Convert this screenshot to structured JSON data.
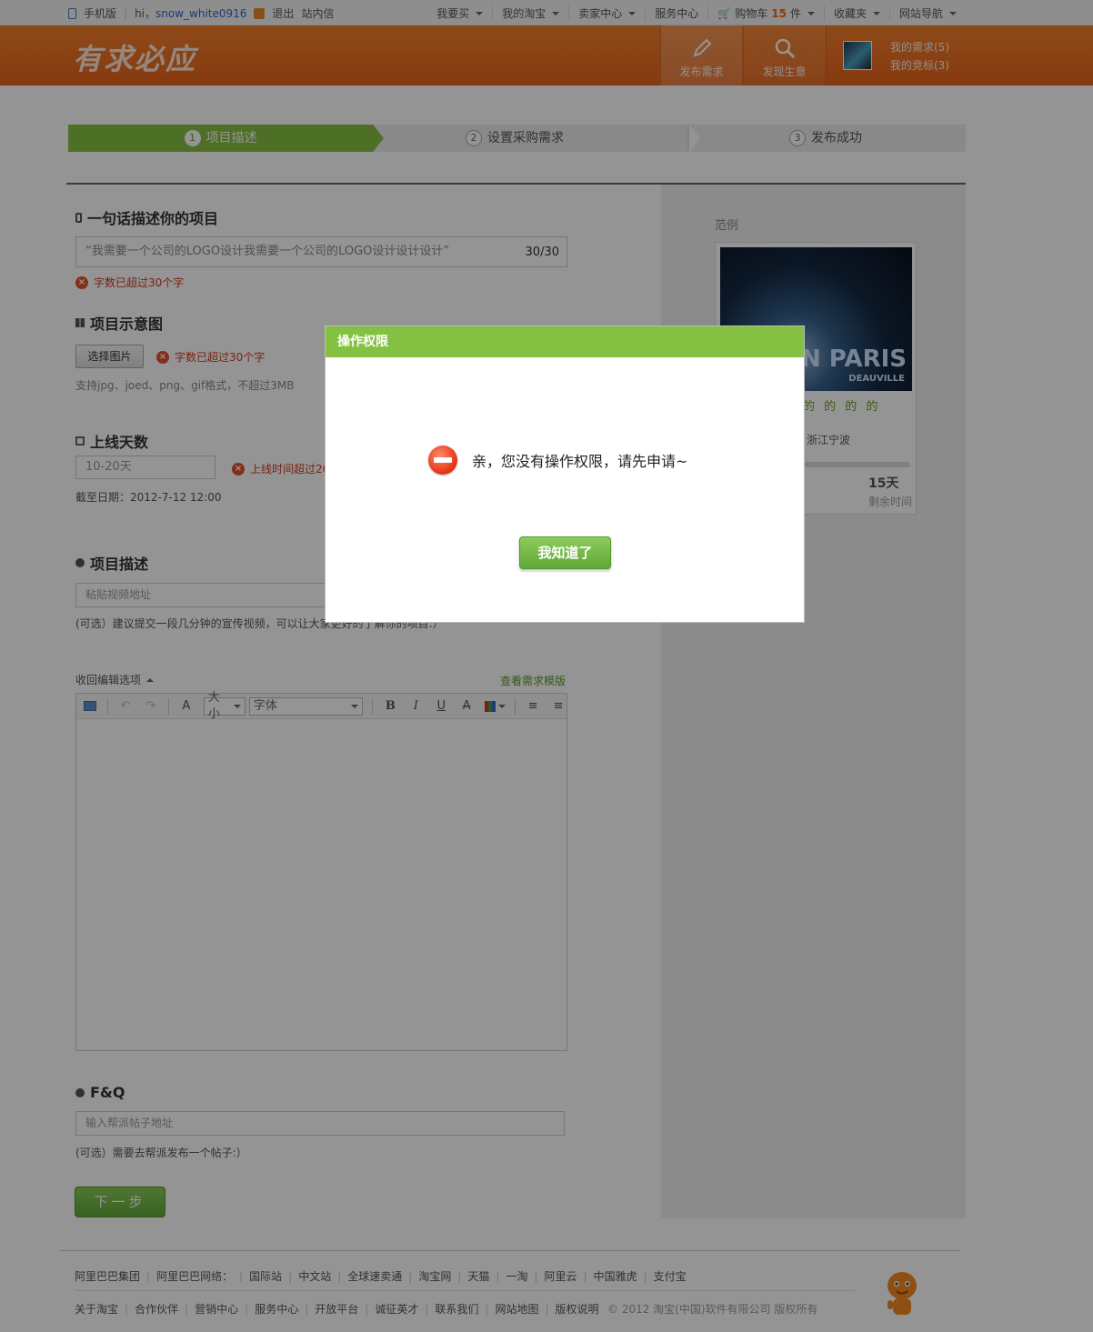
{
  "topbar": {
    "mobile": "手机版",
    "hi": "hi，",
    "username": "snow_white0916",
    "logout": "退出",
    "inbox": "站内信",
    "menu": [
      "我要买",
      "我的淘宝",
      "卖家中心",
      "服务中心"
    ],
    "cart_label": "购物车",
    "cart_count": "15",
    "cart_unit": "件",
    "favorites": "收藏夹",
    "site_nav": "网站导航"
  },
  "header": {
    "logo": "有求必应",
    "publish": "发布需求",
    "discover": "发现生意",
    "my_needs": "我的需求(5)",
    "my_bids": "我的竞标(3)"
  },
  "steps": [
    {
      "num": "1",
      "label": "项目描述"
    },
    {
      "num": "2",
      "label": "设置采购需求"
    },
    {
      "num": "3",
      "label": "发布成功"
    }
  ],
  "form": {
    "title_section": "一句话描述你的项目",
    "title_value": "“我需要一个公司的LOGO设计我需要一个公司的LOGO设计设计设计”",
    "title_counter": "30/30",
    "title_error": "字数已超过30个字",
    "image_section": "项目示意图",
    "choose_image": "选择图片",
    "image_error": "字数已超过30个字",
    "image_hint": "支持jpg、joed、png、gif格式，不超过3MB",
    "days_section": "上线天数",
    "days_placeholder": "10-20天",
    "days_error": "上线时间超过20",
    "deadline": "截至日期：2012-7-12 12:00",
    "desc_section": "项目描述",
    "video_placeholder": "粘贴视频地址",
    "video_hint": "(可选）建议提交一段几分钟的宣传视频，可以让大家更好的了解你的项目:）",
    "collapse_options": "收回编辑选项",
    "view_template": "查看需求模版",
    "toolbar_size": "大小",
    "toolbar_font": "字体",
    "faq_section": "F&Q",
    "faq_placeholder": "输入帮派帖子地址",
    "faq_hint": "(可选）需要去帮派发布一个帖子:）",
    "next": "下一步"
  },
  "example": {
    "label": "范例",
    "img_text": "ON PARIS",
    "img_sub": "DEAUVILLE",
    "title": "的 的 的 的",
    "location": "浙江宁波",
    "days": "15天",
    "remain": "剩余时间"
  },
  "footer": {
    "row1": [
      "阿里巴巴集团",
      "阿里巴巴网络：",
      "国际站",
      "中文站",
      "全球速卖通",
      "淘宝网",
      "天猫",
      "一淘",
      "阿里云",
      "中国雅虎",
      "支付宝"
    ],
    "row2": [
      "关于淘宝",
      "合作伙伴",
      "营销中心",
      "服务中心",
      "开放平台",
      "诚征英才",
      "联系我们",
      "网站地图",
      "版权说明"
    ],
    "copyright": "© 2012 淘宝(中国)软件有限公司 版权所有"
  },
  "dialog": {
    "title": "操作权限",
    "message": "亲，您没有操作权限，请先申请~",
    "ok": "我知道了"
  },
  "colors": {
    "orange": "#e8651b",
    "green": "#84c143",
    "error": "#d03b22"
  }
}
